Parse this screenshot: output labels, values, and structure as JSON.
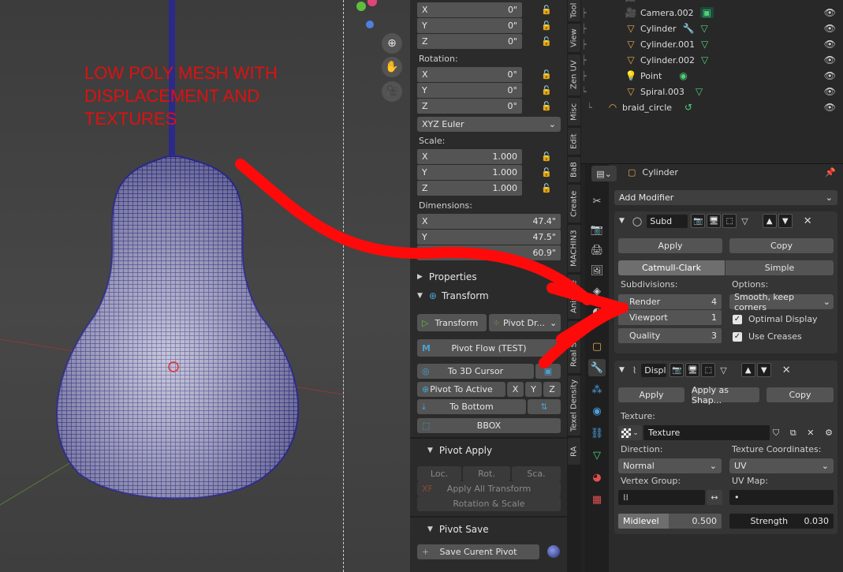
{
  "annotation": "LOW POLY MESH WITH\nDISPLACEMENT AND\nTEXTURES",
  "location": {
    "rows": [
      {
        "axis": "X",
        "value": "0\""
      },
      {
        "axis": "Y",
        "value": "0\""
      },
      {
        "axis": "Z",
        "value": "0\""
      }
    ]
  },
  "rotation": {
    "label": "Rotation:",
    "rows": [
      {
        "axis": "X",
        "value": "0°"
      },
      {
        "axis": "Y",
        "value": "0°"
      },
      {
        "axis": "Z",
        "value": "0°"
      }
    ],
    "mode": "XYZ Euler"
  },
  "scale": {
    "label": "Scale:",
    "rows": [
      {
        "axis": "X",
        "value": "1.000"
      },
      {
        "axis": "Y",
        "value": "1.000"
      },
      {
        "axis": "Z",
        "value": "1.000"
      }
    ]
  },
  "dimensions": {
    "label": "Dimensions:",
    "rows": [
      {
        "axis": "X",
        "value": "47.4\""
      },
      {
        "axis": "Y",
        "value": "47.5\""
      },
      {
        "axis": "Z",
        "value": "60.9\""
      }
    ]
  },
  "properties_header": "Properties",
  "pivot_transform_header": "Transform",
  "pivot": {
    "transform_btn": "Transform",
    "pivot_drop_btn": "Pivot Dr...",
    "pivot_flow_btn": "Pivot Flow (TEST)",
    "to_cursor_btn": "To 3D Cursor",
    "to_active_btn": "Pivot To Active",
    "axis_x": "X",
    "axis_y": "Y",
    "axis_z": "Z",
    "to_bottom_btn": "To Bottom",
    "bbox_btn": "BBOX"
  },
  "pivot_apply": {
    "header": "Pivot Apply",
    "loc": "Loc.",
    "rot": "Rot.",
    "sca": "Sca.",
    "apply_all": "Apply All Transform",
    "rot_scale": "Rotation & Scale"
  },
  "pivot_save": {
    "header": "Pivot Save",
    "save_btn": "Save Curent Pivot"
  },
  "vertical_tabs": [
    "Tool",
    "View",
    "Zen UV",
    "Misc",
    "Edit",
    "BaB",
    "Create",
    "MACHIN3",
    "Animate",
    "Real Snap",
    "Texel Density",
    "RA"
  ],
  "outliner": {
    "items": [
      {
        "name": "Camera.002",
        "icon": "camera-icon"
      },
      {
        "name": "Cylinder",
        "icon": "mesh-icon"
      },
      {
        "name": "Cylinder.001",
        "icon": "mesh-icon"
      },
      {
        "name": "Cylinder.002",
        "icon": "mesh-icon"
      },
      {
        "name": "Point",
        "icon": "light-icon"
      },
      {
        "name": "Spiral.003",
        "icon": "mesh-icon"
      },
      {
        "name": "braid_circle",
        "icon": "curve-icon"
      }
    ]
  },
  "props": {
    "object_name": "Cylinder",
    "add_modifier": "Add Modifier",
    "subsurf": {
      "name": "Subd",
      "apply": "Apply",
      "copy": "Copy",
      "mode_catmull": "Catmull-Clark",
      "mode_simple": "Simple",
      "subdivisions_label": "Subdivisions:",
      "options_label": "Options:",
      "render_label": "Render",
      "render_value": "4",
      "viewport_label": "Viewport",
      "viewport_value": "1",
      "quality_label": "Quality",
      "quality_value": "3",
      "uv_smooth": "Smooth, keep corners",
      "optimal_display": "Optimal Display",
      "use_creases": "Use Creases"
    },
    "displace": {
      "name": "Displ",
      "apply": "Apply",
      "apply_shape": "Apply as Shap...",
      "copy": "Copy",
      "texture_label": "Texture:",
      "texture_name": "Texture",
      "direction_label": "Direction:",
      "direction_value": "Normal",
      "texcoords_label": "Texture Coordinates:",
      "texcoords_value": "UV",
      "vgroup_label": "Vertex Group:",
      "uvmap_label": "UV Map:",
      "uvmap_value": "•",
      "midlevel_label": "Midlevel",
      "midlevel_value": "0.500",
      "strength_label": "Strength",
      "strength_value": "0.030"
    }
  }
}
